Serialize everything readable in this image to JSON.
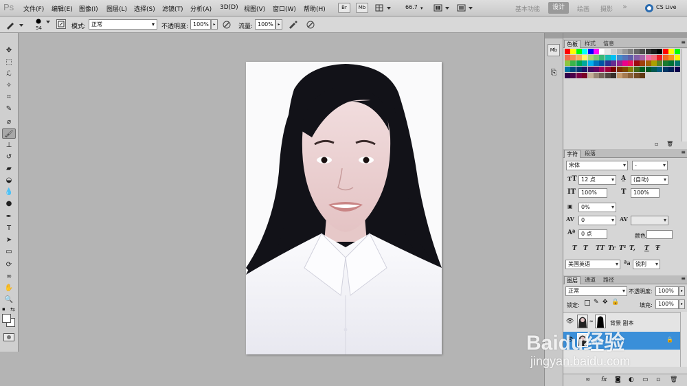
{
  "app": {
    "logo": "Ps"
  },
  "menu": [
    "文件(F)",
    "编辑(E)",
    "图像(I)",
    "图层(L)",
    "选择(S)",
    "滤镜(T)",
    "分析(A)",
    "3D(D)",
    "视图(V)",
    "窗口(W)",
    "帮助(H)"
  ],
  "menubar": {
    "bridge_label": "Br",
    "minibridge_label": "Mb",
    "zoom": "66.7",
    "workspaces": [
      "基本功能",
      "设计",
      "绘画",
      "摄影"
    ],
    "active_workspace": "设计",
    "more": "»",
    "cs_live": "CS Live"
  },
  "options": {
    "brush_size": "54",
    "mode_label": "模式:",
    "mode_value": "正常",
    "opacity_label": "不透明度:",
    "opacity_value": "100%",
    "flow_label": "流量:",
    "flow_value": "100%"
  },
  "swatches_panel": {
    "tabs": [
      "色板",
      "样式",
      "信息"
    ],
    "colors": [
      "#ff0000",
      "#ffff00",
      "#00ff00",
      "#00ffff",
      "#0000ff",
      "#ff00ff",
      "#ffffff",
      "#e6e6e6",
      "#cccccc",
      "#b3b3b3",
      "#999999",
      "#808080",
      "#666666",
      "#4d4d4d",
      "#333333",
      "#1a1a1a",
      "#000000",
      "#ff0000",
      "#ffff00",
      "#00ff00",
      "#f26c4f",
      "#f68e55",
      "#fbaf5c",
      "#fff467",
      "#acd372",
      "#7cc576",
      "#3bb878",
      "#1abbb4",
      "#00bff3",
      "#438ccb",
      "#5574b9",
      "#605ca8",
      "#855fa8",
      "#a763a8",
      "#f06ea9",
      "#f26d7d",
      "#ed1c24",
      "#f26522",
      "#f7941d",
      "#fff200",
      "#8dc63f",
      "#39b54a",
      "#00a651",
      "#00a99d",
      "#00aeef",
      "#0072bc",
      "#0054a6",
      "#2e3192",
      "#662d91",
      "#92278f",
      "#ec008c",
      "#ed145b",
      "#9e0b0f",
      "#a0410d",
      "#a36209",
      "#aba000",
      "#598527",
      "#197b30",
      "#007236",
      "#00746b",
      "#0076a3",
      "#004b80",
      "#003471",
      "#1b1464",
      "#440e62",
      "#630460",
      "#9e005d",
      "#9e0039",
      "#790000",
      "#7b2e00",
      "#7d4900",
      "#827b00",
      "#406618",
      "#005e20",
      "#005826",
      "#005952",
      "#005b7f",
      "#003663",
      "#002157",
      "#0d004c",
      "#32004b",
      "#4b0049",
      "#7b0046",
      "#7a0026",
      "#c7b299",
      "#998675",
      "#736357",
      "#534741",
      "#37302a",
      "#c69c6d",
      "#a67c52",
      "#8c6239",
      "#754c24",
      "#603913"
    ],
    "footer_icons": [
      "new-icon",
      "delete-icon"
    ]
  },
  "character_panel": {
    "tabs": [
      "字符",
      "段落"
    ],
    "font_family": "宋体",
    "font_style": "-",
    "font_size": "12 点",
    "leading": "(自动)",
    "vertical_scale": "100%",
    "horizontal_scale": "100%",
    "tracking_pct": "0%",
    "kerning": "0",
    "tracking": "",
    "baseline_shift": "0 点",
    "color_label": "颜色:",
    "style_buttons": [
      "T",
      "T",
      "TT",
      "Tr",
      "T¹",
      "T,",
      "T",
      "Ŧ"
    ],
    "language": "美国英语",
    "aa_label": "ªa",
    "antialias": "锐利"
  },
  "layers_panel": {
    "tabs": [
      "图层",
      "通道",
      "路径"
    ],
    "blend_mode": "正常",
    "opacity_label": "不透明度:",
    "opacity_value": "100%",
    "lock_label": "锁定:",
    "fill_label": "填充:",
    "fill_value": "100%",
    "layers": [
      {
        "name": "背景 副本",
        "selected": false,
        "visible": true
      },
      {
        "name": "背景",
        "selected": true,
        "visible": true
      }
    ]
  },
  "watermark": {
    "brand": "Baidu经验",
    "url": "jingyan.baidu.com"
  }
}
